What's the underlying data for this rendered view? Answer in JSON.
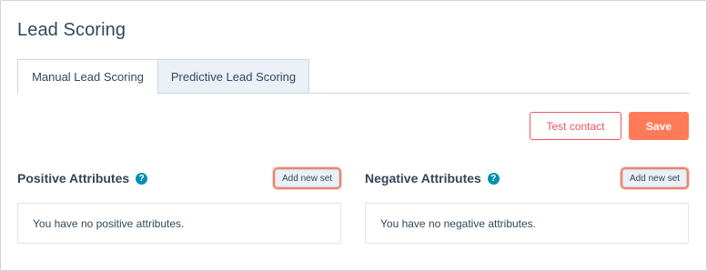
{
  "header": {
    "title": "Lead Scoring"
  },
  "tabs": [
    {
      "label": "Manual Lead Scoring",
      "active": true
    },
    {
      "label": "Predictive Lead Scoring",
      "active": false
    }
  ],
  "actions": {
    "test_label": "Test contact",
    "save_label": "Save"
  },
  "positive": {
    "title": "Positive Attributes",
    "help": "?",
    "add_label": "Add new set",
    "empty_text": "You have no positive attributes."
  },
  "negative": {
    "title": "Negative Attributes",
    "help": "?",
    "add_label": "Add new set",
    "empty_text": "You have no negative attributes."
  },
  "colors": {
    "accent": "#ff7a59",
    "danger_outline": "#f2545b",
    "help": "#0091ae",
    "highlight": "#f0846b"
  }
}
